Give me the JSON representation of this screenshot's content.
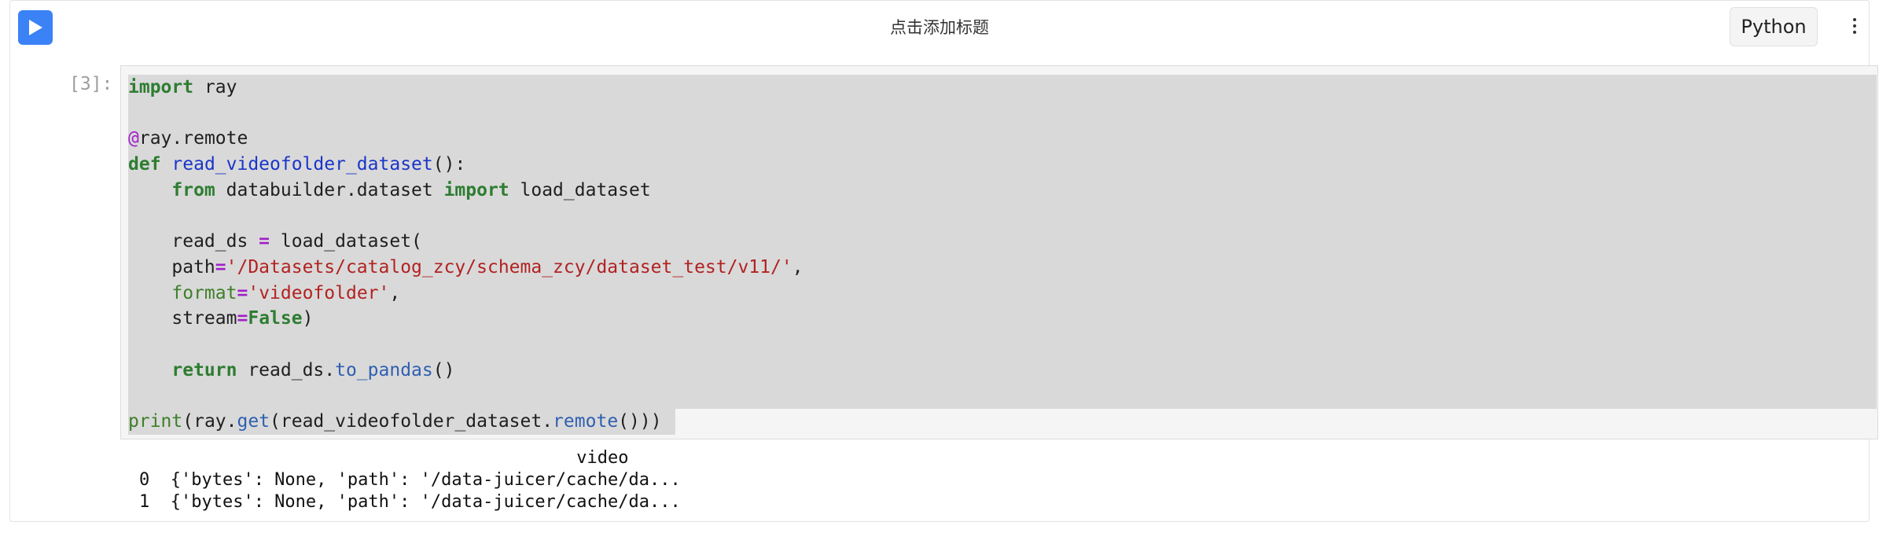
{
  "toolbar": {
    "run_icon": "play-icon",
    "title": "点击添加标题",
    "kernel_label": "Python",
    "more_icon": "vertical-ellipsis-icon",
    "accent_color": "#3b82f6"
  },
  "cell": {
    "prompt": "[3]:",
    "code": {
      "l1": {
        "kw": "import",
        "rest": " ray"
      },
      "l3": {
        "at": "@",
        "rest": "ray.remote"
      },
      "l4": {
        "kw": "def",
        "fn": "read_videofolder_dataset",
        "rest": "():"
      },
      "l5": {
        "indent": "    ",
        "kw1": "from",
        "mid": " databuilder.dataset ",
        "kw2": "import",
        "rest": " load_dataset"
      },
      "l7": {
        "indent": "    ",
        "var": "read_ds ",
        "op": "=",
        "rest": " load_dataset("
      },
      "l8": {
        "indent": "    ",
        "arg": "path",
        "op": "=",
        "str": "'/Datasets/catalog_zcy/schema_zcy/dataset_test/v11/'",
        "rest": ","
      },
      "l9": {
        "indent": "    ",
        "arg": "format",
        "op": "=",
        "str": "'videofolder'",
        "rest": ","
      },
      "l10": {
        "indent": "    ",
        "arg": "stream",
        "op": "=",
        "val": "False",
        "rest": ")"
      },
      "l12": {
        "indent": "    ",
        "kw": "return",
        "mid": " read_ds.",
        "attr": "to_pandas",
        "rest": "()"
      },
      "l14": {
        "bi": "print",
        "p1": "(ray.",
        "attr1": "get",
        "p2": "(read_videofolder_dataset.",
        "attr2": "remote",
        "rest": "()))"
      }
    }
  },
  "output": {
    "header": "                                          video",
    "rows": [
      "0  {'bytes': None, 'path': '/data-juicer/cache/da...",
      "1  {'bytes': None, 'path': '/data-juicer/cache/da..."
    ]
  }
}
